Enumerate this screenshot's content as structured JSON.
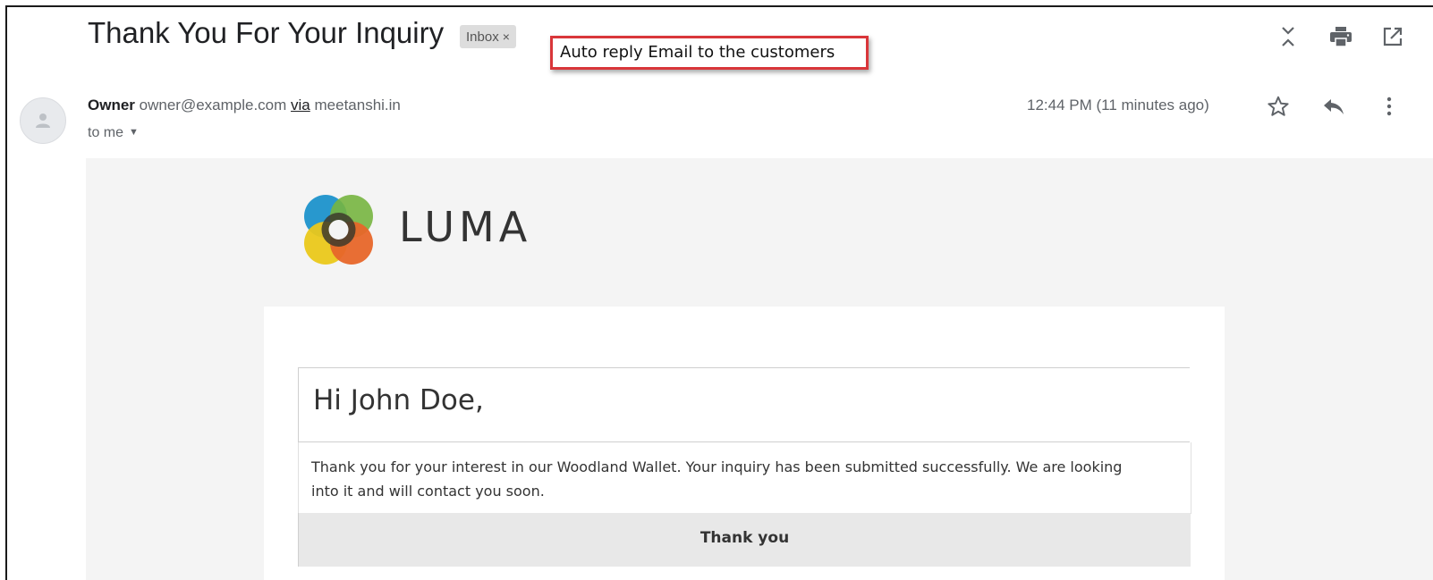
{
  "subject": "Thank You For Your Inquiry",
  "label_chip": {
    "text": "Inbox",
    "close": "×"
  },
  "annotation": "Auto reply Email to the customers",
  "toolbar": {
    "icons": [
      "expand-collapse-icon",
      "print-icon",
      "open-new-window-icon"
    ]
  },
  "message": {
    "sender_name": "Owner",
    "sender_email": "owner@example.com",
    "via": "via",
    "via_domain": "meetanshi.in",
    "to": "to me",
    "timestamp": "12:44 PM (11 minutes ago)",
    "actions": [
      "star-icon",
      "reply-icon",
      "more-vert-icon"
    ]
  },
  "email": {
    "logo_text": "LUMA",
    "greeting": "Hi John Doe,",
    "body": "Thank you for your interest in our Woodland Wallet. Your inquiry has been submitted successfully. We are looking into it and will contact you soon.",
    "signoff": "Thank you"
  },
  "colors": {
    "annotation_border": "#d9363a",
    "email_background": "#f4f4f4",
    "signoff_bar": "#e8e8e8",
    "logo_blue": "#1e9ad6",
    "logo_green": "#7cbe42",
    "logo_yellow": "#f6d21b",
    "logo_orange": "#f26b2b"
  }
}
